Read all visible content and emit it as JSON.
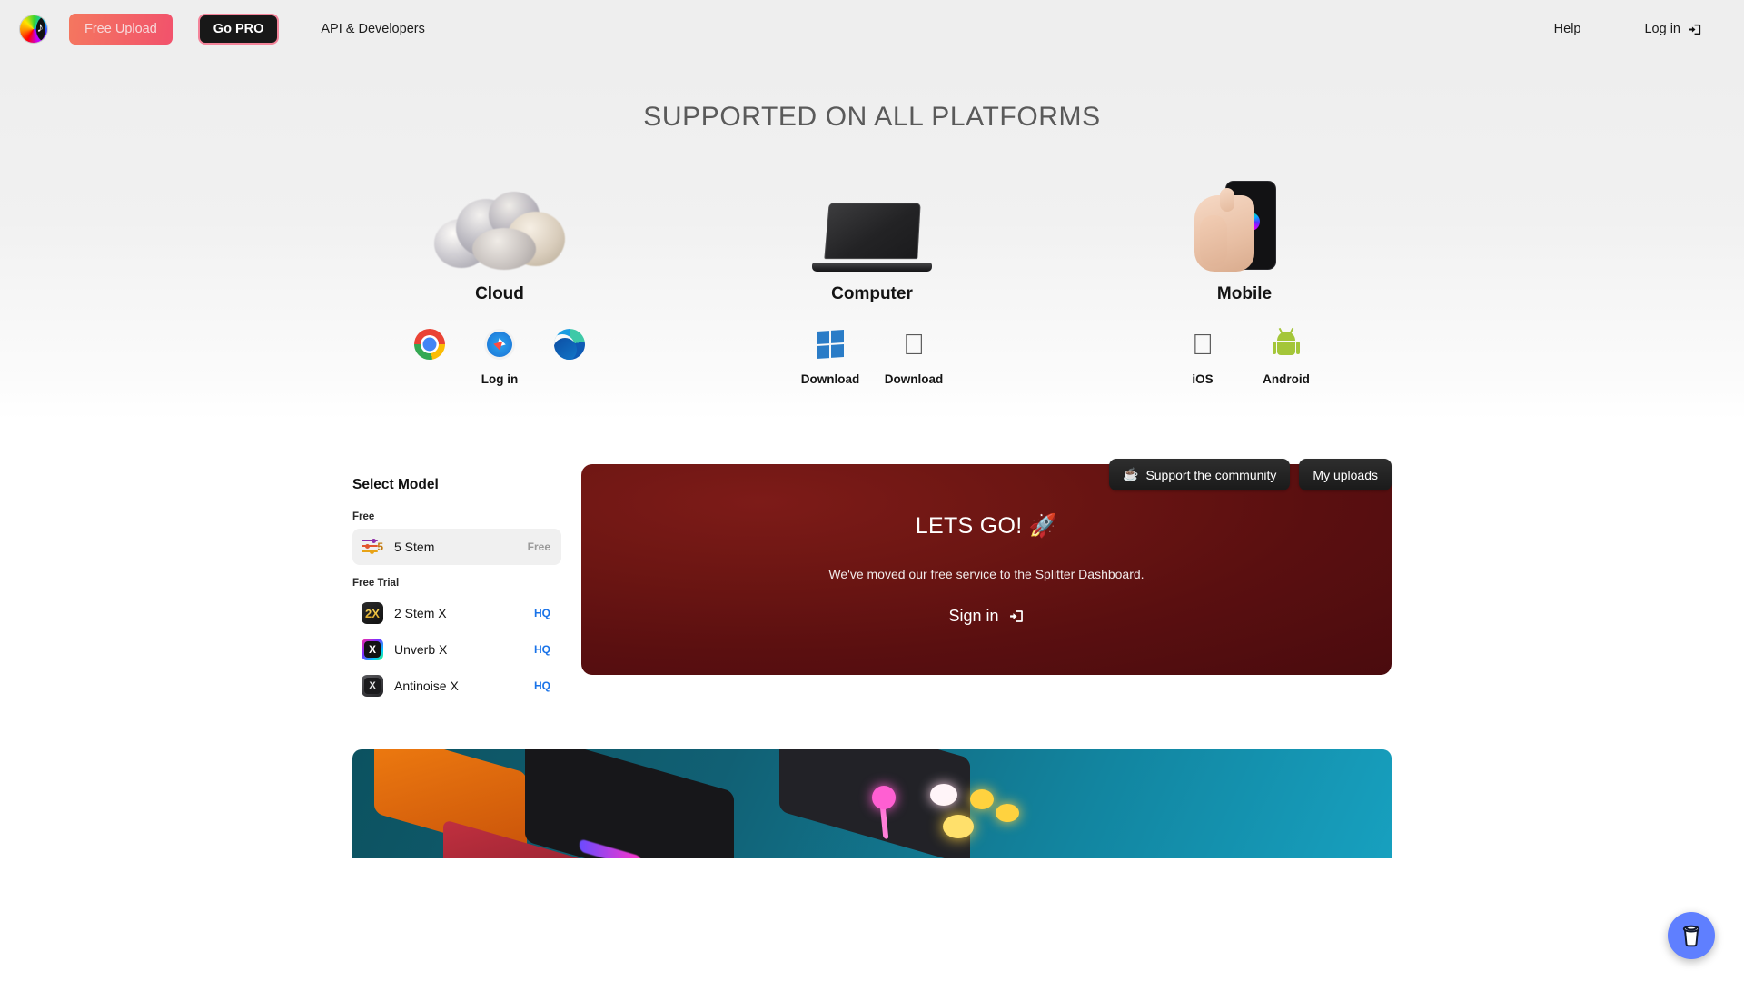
{
  "navbar": {
    "logo_name": "splitter-logo",
    "free_upload_label": "Free Upload",
    "go_pro_label": "Go PRO",
    "api_label": "API & Developers",
    "help_label": "Help",
    "login_label": "Log in"
  },
  "platforms_section": {
    "title": "SUPPORTED ON ALL PLATFORMS",
    "items": [
      {
        "name": "Cloud",
        "visual": "cloud-illustration",
        "icons": [
          {
            "icon": "chrome-icon",
            "label": ""
          },
          {
            "icon": "safari-icon",
            "label": "Log in"
          },
          {
            "icon": "edge-icon",
            "label": ""
          }
        ]
      },
      {
        "name": "Computer",
        "visual": "laptop-illustration",
        "icons": [
          {
            "icon": "windows-icon",
            "label": "Download"
          },
          {
            "icon": "apple-icon",
            "label": "Download"
          }
        ]
      },
      {
        "name": "Mobile",
        "visual": "phone-in-hand-illustration",
        "icons": [
          {
            "icon": "apple-icon",
            "label": "iOS"
          },
          {
            "icon": "android-icon",
            "label": "Android"
          }
        ]
      }
    ]
  },
  "workspace": {
    "support_button": "Support the community",
    "support_icon": "coffee-icon",
    "uploads_button": "My uploads",
    "model_panel": {
      "title": "Select Model",
      "groups": [
        {
          "label": "Free",
          "models": [
            {
              "name": "5 Stem",
              "tag": "Free",
              "tag_type": "free",
              "icon": "mixer-5-icon",
              "badge": "5",
              "selected": true
            }
          ]
        },
        {
          "label": "Free Trial",
          "models": [
            {
              "name": "2 Stem X",
              "tag": "HQ",
              "tag_type": "hq",
              "icon": "2stemx-app-icon",
              "badge": "2X",
              "selected": false
            },
            {
              "name": "Unverb X",
              "tag": "HQ",
              "tag_type": "hq",
              "icon": "unverbx-app-icon",
              "badge": "X",
              "selected": false
            },
            {
              "name": "Antinoise X",
              "tag": "HQ",
              "tag_type": "hq",
              "icon": "antinoisex-app-icon",
              "badge": "X",
              "selected": false
            }
          ]
        }
      ]
    },
    "hero": {
      "title": "LETS GO! 🚀",
      "subtitle": "We've moved our free service to the Splitter Dashboard.",
      "cta_label": "Sign in"
    }
  },
  "fab": {
    "icon": "coffee-cup-icon",
    "color": "#5f7fff"
  },
  "colors": {
    "nav_background": "#eeeeee",
    "accent_pink": "#f2526c",
    "hero_red": "#6d1613",
    "hq_blue": "#1a73e8",
    "teal_banner": "#116074"
  }
}
